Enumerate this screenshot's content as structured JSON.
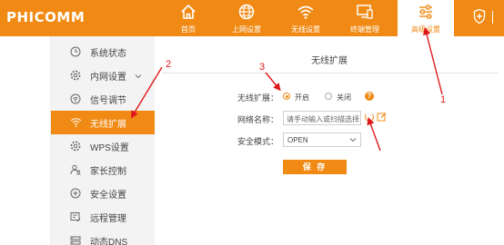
{
  "brand": "PHICOMM",
  "nav": [
    {
      "label": "首页",
      "icon": "home-icon"
    },
    {
      "label": "上网设置",
      "icon": "globe-icon"
    },
    {
      "label": "无线设置",
      "icon": "wifi-icon"
    },
    {
      "label": "终端管理",
      "icon": "monitor-icon"
    },
    {
      "label": "高级设置",
      "icon": "sliders-icon",
      "active": true
    }
  ],
  "sidebar": {
    "items": [
      {
        "label": "系统状态",
        "icon": "clock-icon"
      },
      {
        "label": "内网设置",
        "icon": "gear-icon",
        "expandable": true
      },
      {
        "label": "信号调节",
        "icon": "signal-icon"
      },
      {
        "label": "无线扩展",
        "icon": "wifi-extend-icon",
        "active": true
      },
      {
        "label": "WPS设置",
        "icon": "wps-gear-icon"
      },
      {
        "label": "家长控制",
        "icon": "parent-icon"
      },
      {
        "label": "安全设置",
        "icon": "shield-icon"
      },
      {
        "label": "远程管理",
        "icon": "remote-icon"
      },
      {
        "label": "动态DNS",
        "icon": "dns-icon"
      }
    ]
  },
  "main": {
    "title": "无线扩展",
    "ext_label": "无线扩展：",
    "ext_on": "开启",
    "ext_off": "关闭",
    "ssid_label": "网络名称：",
    "ssid_placeholder": "请手动输入或扫描选择",
    "security_label": "安全模式：",
    "security_value": "OPEN",
    "save_label": "保 存"
  },
  "annotations": [
    "1",
    "2",
    "3"
  ],
  "colors": {
    "accent": "#f08a14",
    "annotation": "#e0181b"
  }
}
